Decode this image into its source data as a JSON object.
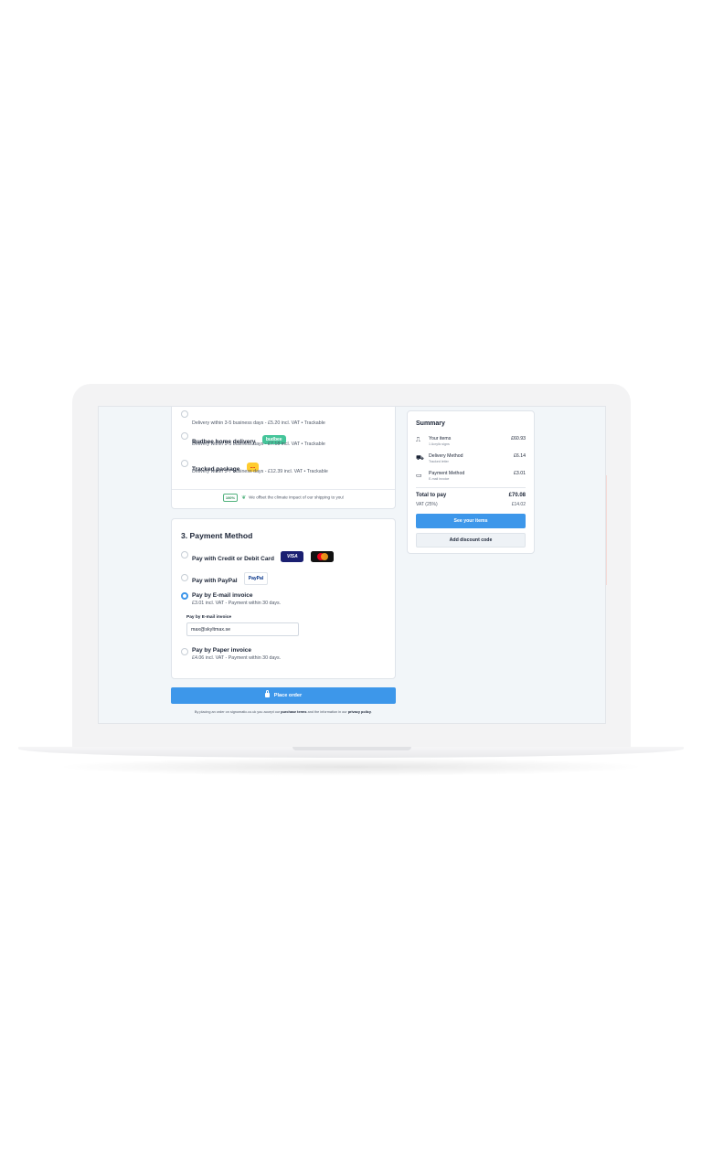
{
  "delivery": {
    "options": [
      {
        "title": "",
        "subtitle": "Delivery within 3-5 business days - £5.20 incl. VAT • Trackable",
        "selected": false
      },
      {
        "title": "Budbee home delivery",
        "logo": "budbee",
        "subtitle": "Delivery within 3-5 business days - £7.18 incl. VAT • Trackable",
        "selected": false
      },
      {
        "title": "Tracked package",
        "logo": "....",
        "subtitle": "Delivery within 3-7 business days - £12.39 incl. VAT • Trackable",
        "selected": false
      }
    ],
    "eco_badge": "100%",
    "eco_text": "We offset the climate impact of our shipping to you!"
  },
  "payment": {
    "title": "3. Payment Method",
    "options": [
      {
        "title": "Pay with Credit or Debit Card",
        "logos": [
          "VISA",
          "mastercard"
        ],
        "selected": false
      },
      {
        "title": "Pay with PayPal",
        "logo": "PayPal",
        "selected": false
      },
      {
        "title": "Pay by E-mail invoice",
        "subtitle": "£3.01 incl. VAT - Payment within 30 days.",
        "selected": true
      },
      {
        "title": "Pay by Paper invoice",
        "subtitle": "£4.06 incl. VAT - Payment within 30 days.",
        "selected": false
      }
    ],
    "email_field_label": "Pay by E-mail invoice",
    "email_field_value": "max@skyltmax.se"
  },
  "place_order": {
    "label": "Place order",
    "terms_prefix": "By placing an order on signomatic.co.uk you accept our ",
    "terms_link": "purchase terms",
    "terms_middle": " and the information in our ",
    "privacy_link": "privacy policy",
    "terms_suffix": "."
  },
  "summary": {
    "title": "Summary",
    "rows": [
      {
        "label": "Your items",
        "sub": "1 Acrylic signs",
        "value": "£60.93",
        "icon": "box-icon"
      },
      {
        "label": "Delivery Method",
        "sub": "Tracked letter",
        "value": "£6.14",
        "icon": "truck-icon"
      },
      {
        "label": "Payment Method",
        "sub": "E-mail invoice",
        "value": "£3.01",
        "icon": "credit-card-icon"
      }
    ],
    "total_label": "Total to pay",
    "total_value": "£70.08",
    "vat_label": "VAT (25%)",
    "vat_value": "£14.02",
    "see_items_label": "See your items",
    "discount_label": "Add discount code"
  },
  "colors": {
    "accent": "#3d97ea",
    "budbee": "#45c59a",
    "dhl_yellow": "#ffcc2f"
  }
}
